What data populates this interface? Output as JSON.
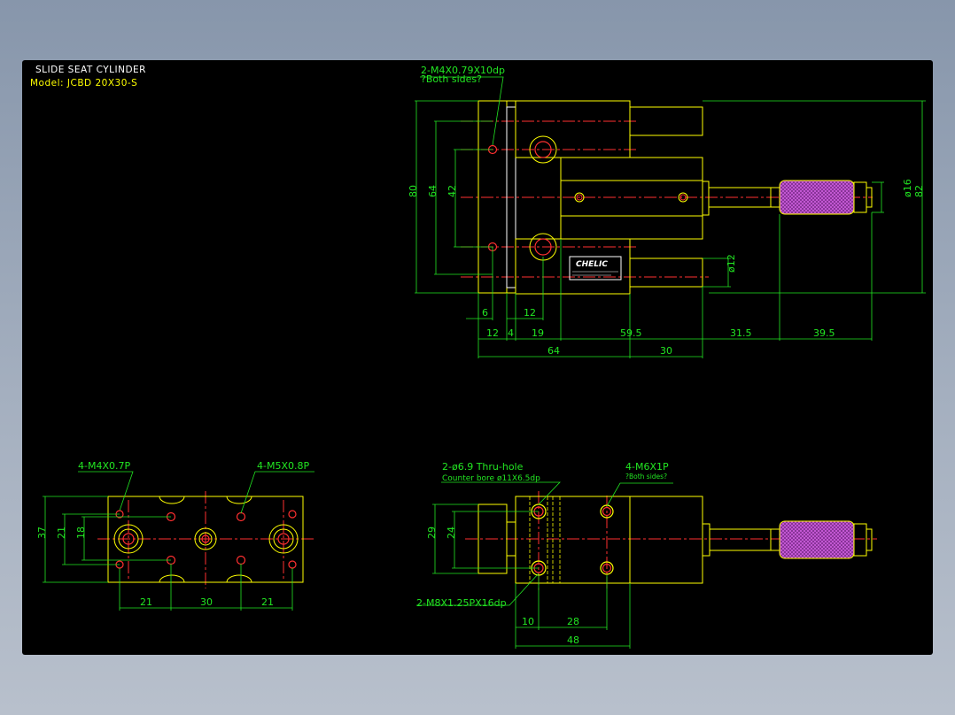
{
  "drawing": {
    "title": "SLIDE SEAT CYLINDER",
    "model": "Model: JCBD 20X30-S",
    "brand": "CHELIC"
  },
  "top_view": {
    "callout_1": "2-M4X0.79X10dp",
    "callout_2": "?Both sides?",
    "dims": {
      "h80": "80",
      "h64": "64",
      "h42": "42",
      "h82": "82",
      "d16": "ø16",
      "d12": "ø12",
      "a6": "6",
      "a12": "12",
      "b12": "12",
      "b4": "4",
      "b19": "19",
      "b59_5": "59.5",
      "b31_5": "31.5",
      "b39_5": "39.5",
      "c64": "64",
      "c30": "30"
    }
  },
  "end_view": {
    "callout_left": "4-M4X0.7P",
    "callout_right": "4-M5X0.8P",
    "dims": {
      "v37": "37",
      "v21": "21",
      "v18": "18",
      "w21a": "21",
      "w30": "30",
      "w21b": "21"
    }
  },
  "bottom_view": {
    "callout_1": "2-ø6.9  Thru-hole",
    "callout_2": "Counter bore  ø11X6.5dp",
    "callout_3": "4-M6X1P",
    "callout_4": "?Both sides?",
    "callout_5": "2-M8X1.25PX16dp",
    "dims": {
      "v29": "29",
      "v24": "24",
      "w10": "10",
      "w28": "28",
      "w48": "48"
    }
  }
}
